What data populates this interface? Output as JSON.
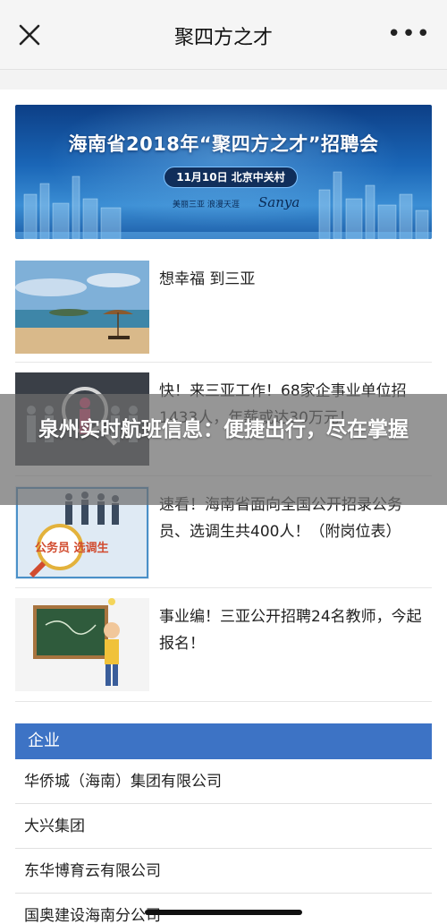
{
  "navbar": {
    "title": "聚四方之才",
    "close_icon": "close-icon",
    "more_icon": "more-dots-icon"
  },
  "banner": {
    "title": "海南省2018年“聚四方之才”招聘会",
    "date_location": "11月10日 北京中关村",
    "logos_text": "美丽三亚 浪漫天涯",
    "brand": "Sanya"
  },
  "articles": [
    {
      "title": "想幸福 到三亚"
    },
    {
      "title": "快！来三亚工作！68家企事业单位招1433人，年薪或达30万元！"
    },
    {
      "title": "速看！海南省面向全国公开招录公务员、选调生共400人！（附岗位表）",
      "thumb_label": "公务员 选调生"
    },
    {
      "title": "事业编！三亚公开招聘24名教师，今起报名！"
    }
  ],
  "overlay": {
    "headline": "泉州实时航班信息：便捷出行，尽在掌握"
  },
  "companies_section": {
    "header": "企业",
    "items": [
      "华侨城（海南）集团有限公司",
      "大兴集团",
      "东华博育云有限公司",
      "国奥建设海南分公司"
    ]
  },
  "colors": {
    "section_header_bg": "#3d73c5",
    "navbar_bg": "#f5f5f5",
    "overlay_bg": "#6e6e6e"
  }
}
